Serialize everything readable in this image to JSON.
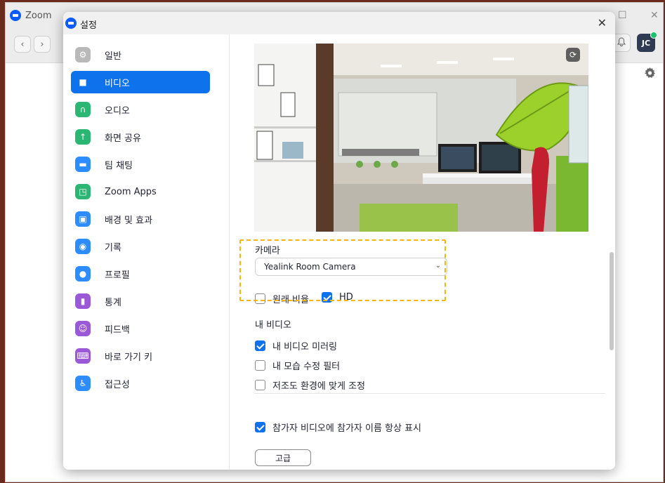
{
  "background_app": {
    "title": "Zoom",
    "back_icon": "chevron-left-icon",
    "forward_icon": "chevron-right-icon",
    "avatar_initials": "JC",
    "window_controls": [
      "minimize-icon",
      "maximize-icon",
      "close-icon"
    ]
  },
  "dialog": {
    "title": "설정",
    "close_label": "✕"
  },
  "sidebar": {
    "items": [
      {
        "label": "일반",
        "icon": "gear-icon",
        "color": "#b9b9b9",
        "active": false
      },
      {
        "label": "비디오",
        "icon": "video-camera-icon",
        "color": "#0e72ed",
        "active": true
      },
      {
        "label": "오디오",
        "icon": "headphones-icon",
        "color": "#2bb673",
        "active": false
      },
      {
        "label": "화면 공유",
        "icon": "share-screen-icon",
        "color": "#2bb673",
        "active": false
      },
      {
        "label": "팀 채팅",
        "icon": "chat-bubble-icon",
        "color": "#2d8cff",
        "active": false
      },
      {
        "label": "Zoom Apps",
        "icon": "apps-icon",
        "color": "#2bb673",
        "active": false
      },
      {
        "label": "배경 및 효과",
        "icon": "background-icon",
        "color": "#2d8cff",
        "active": false
      },
      {
        "label": "기록",
        "icon": "record-icon",
        "color": "#2d8cff",
        "active": false
      },
      {
        "label": "프로필",
        "icon": "profile-icon",
        "color": "#2d8cff",
        "active": false
      },
      {
        "label": "통계",
        "icon": "statistics-icon",
        "color": "#9b59d8",
        "active": false
      },
      {
        "label": "피드백",
        "icon": "feedback-icon",
        "color": "#9b59d8",
        "active": false
      },
      {
        "label": "바로 가기 키",
        "icon": "keyboard-icon",
        "color": "#9b59d8",
        "active": false
      },
      {
        "label": "접근성",
        "icon": "accessibility-icon",
        "color": "#2d8cff",
        "active": false
      }
    ]
  },
  "video": {
    "rotate_icon": "rotate-icon",
    "camera_label": "카메라",
    "camera_selected": "Yealink Room Camera",
    "original_ratio_label": "원래 비율",
    "original_ratio_checked": false,
    "hd_label": "HD",
    "hd_checked": true,
    "my_video_label": "내 비디오",
    "mirror_label": "내 비디오 미러링",
    "mirror_checked": true,
    "touchup_label": "내 모습 수정 필터",
    "touchup_checked": false,
    "lowlight_label": "저조도 환경에 맞게 조정",
    "lowlight_checked": false,
    "show_names_label": "참가자 비디오에 참가자 이름 항상 표시",
    "show_names_checked": true,
    "advanced_label": "고급"
  },
  "colors": {
    "accent": "#0e72ed",
    "highlight": "#f5b40e"
  }
}
